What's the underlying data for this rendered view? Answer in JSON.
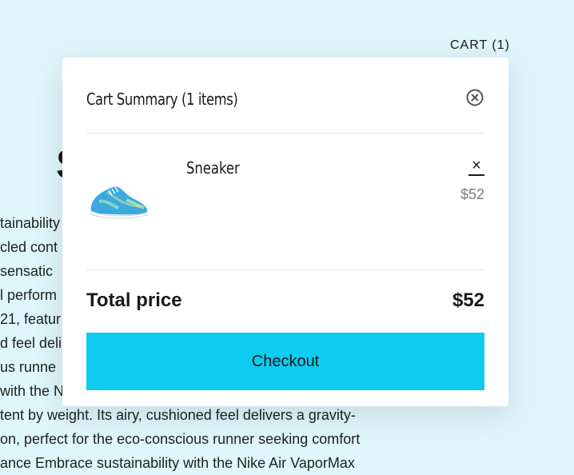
{
  "header": {
    "cart_link": "CART (1)"
  },
  "background": {
    "heading": "S",
    "lines": [
      "tainability",
      "cled cont",
      " sensatic",
      "l perform",
      "21, featur",
      "d feel deli",
      "us runne",
      "with the N",
      "tent by weight. Its airy, cushioned feel delivers a gravity-",
      "on, perfect for the eco-conscious runner seeking comfort",
      "ance Embrace sustainability with the Nike Air VaporMax"
    ]
  },
  "modal": {
    "title": "Cart Summary (1 items)",
    "close_icon": "close-circle-icon",
    "items": [
      {
        "name": "Sneaker",
        "price": "$52",
        "remove_glyph": "×",
        "image": "sneaker-image"
      }
    ],
    "total_label": "Total price",
    "total_value": "$52",
    "checkout_label": "Checkout"
  },
  "colors": {
    "page_background": "#dff6fd",
    "checkout_button": "#0fcbf0",
    "price_muted": "#7a7a7a"
  }
}
